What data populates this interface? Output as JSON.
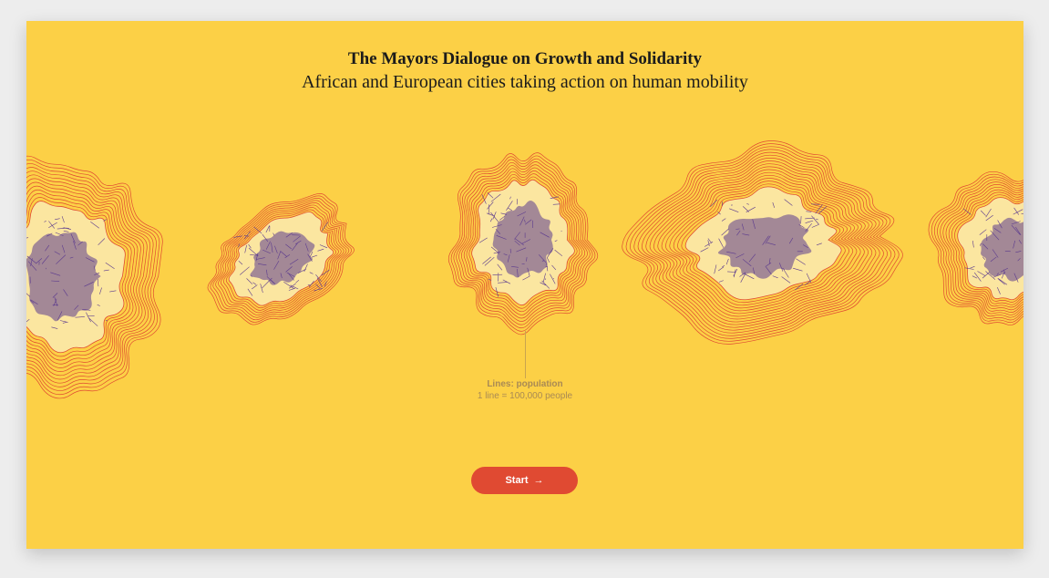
{
  "header": {
    "title": "The Mayors Dialogue on Growth and Solidarity",
    "subtitle": "African and European cities taking action on human mobility"
  },
  "legend": {
    "title": "Lines: population",
    "subtitle": "1 line = 100,000 people"
  },
  "start_button": {
    "label": "Start",
    "icon": "arrow-right-icon"
  },
  "colors": {
    "background": "#fcd046",
    "contour": "#e04a32",
    "land": "#fbe6a0",
    "streets": "#5b3a8e",
    "button": "#e04a32"
  },
  "city_maps": [
    {
      "icon": "city-map-left-partial",
      "contour_lines": 12
    },
    {
      "icon": "city-map-elongated",
      "contour_lines": 8
    },
    {
      "icon": "city-map-center",
      "contour_lines": 9
    },
    {
      "icon": "city-map-rectangular",
      "contour_lines": 16
    },
    {
      "icon": "city-map-right-partial",
      "contour_lines": 10
    }
  ]
}
